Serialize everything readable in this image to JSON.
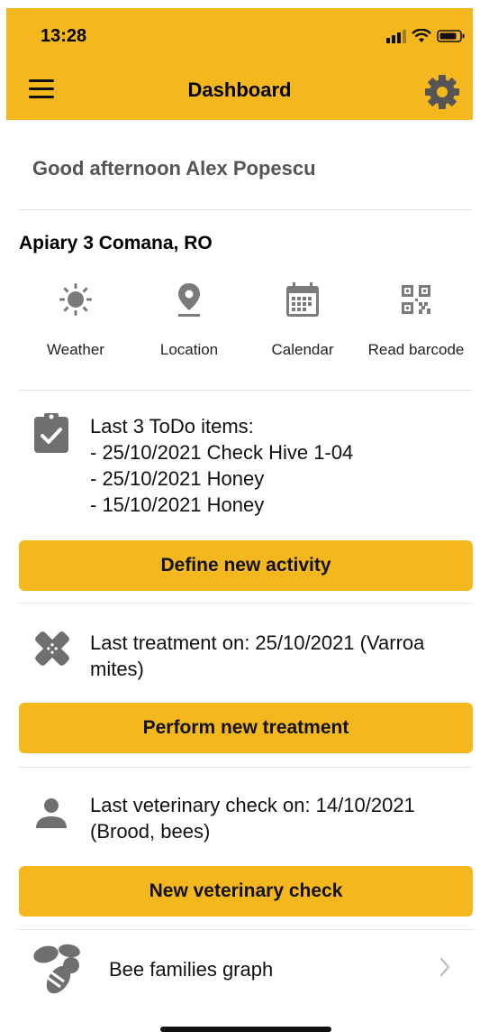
{
  "status": {
    "time": "13:28"
  },
  "nav": {
    "title": "Dashboard"
  },
  "greeting": "Good afternoon Alex Popescu",
  "apiary": {
    "name": "Apiary 3 Comana, RO"
  },
  "tools": [
    {
      "label": "Weather",
      "icon": "sun-icon"
    },
    {
      "label": "Location",
      "icon": "location-pin-icon"
    },
    {
      "label": "Calendar",
      "icon": "calendar-icon"
    },
    {
      "label": "Read barcode",
      "icon": "qr-code-icon"
    }
  ],
  "todo": {
    "header": "Last 3 ToDo items:",
    "items": [
      "- 25/10/2021 Check Hive 1-04",
      "- 25/10/2021 Honey",
      "- 15/10/2021 Honey"
    ],
    "button": "Define new activity"
  },
  "treatment": {
    "text": "Last treatment on: 25/10/2021 (Varroa mites)",
    "button": "Perform new treatment"
  },
  "vet": {
    "text": "Last veterinary check on: 14/10/2021 (Brood, bees)",
    "button": "New veterinary check"
  },
  "graph": {
    "label": "Bee families graph"
  },
  "colors": {
    "accent": "#F4B71D",
    "icon_gray": "#7a7a7a"
  }
}
